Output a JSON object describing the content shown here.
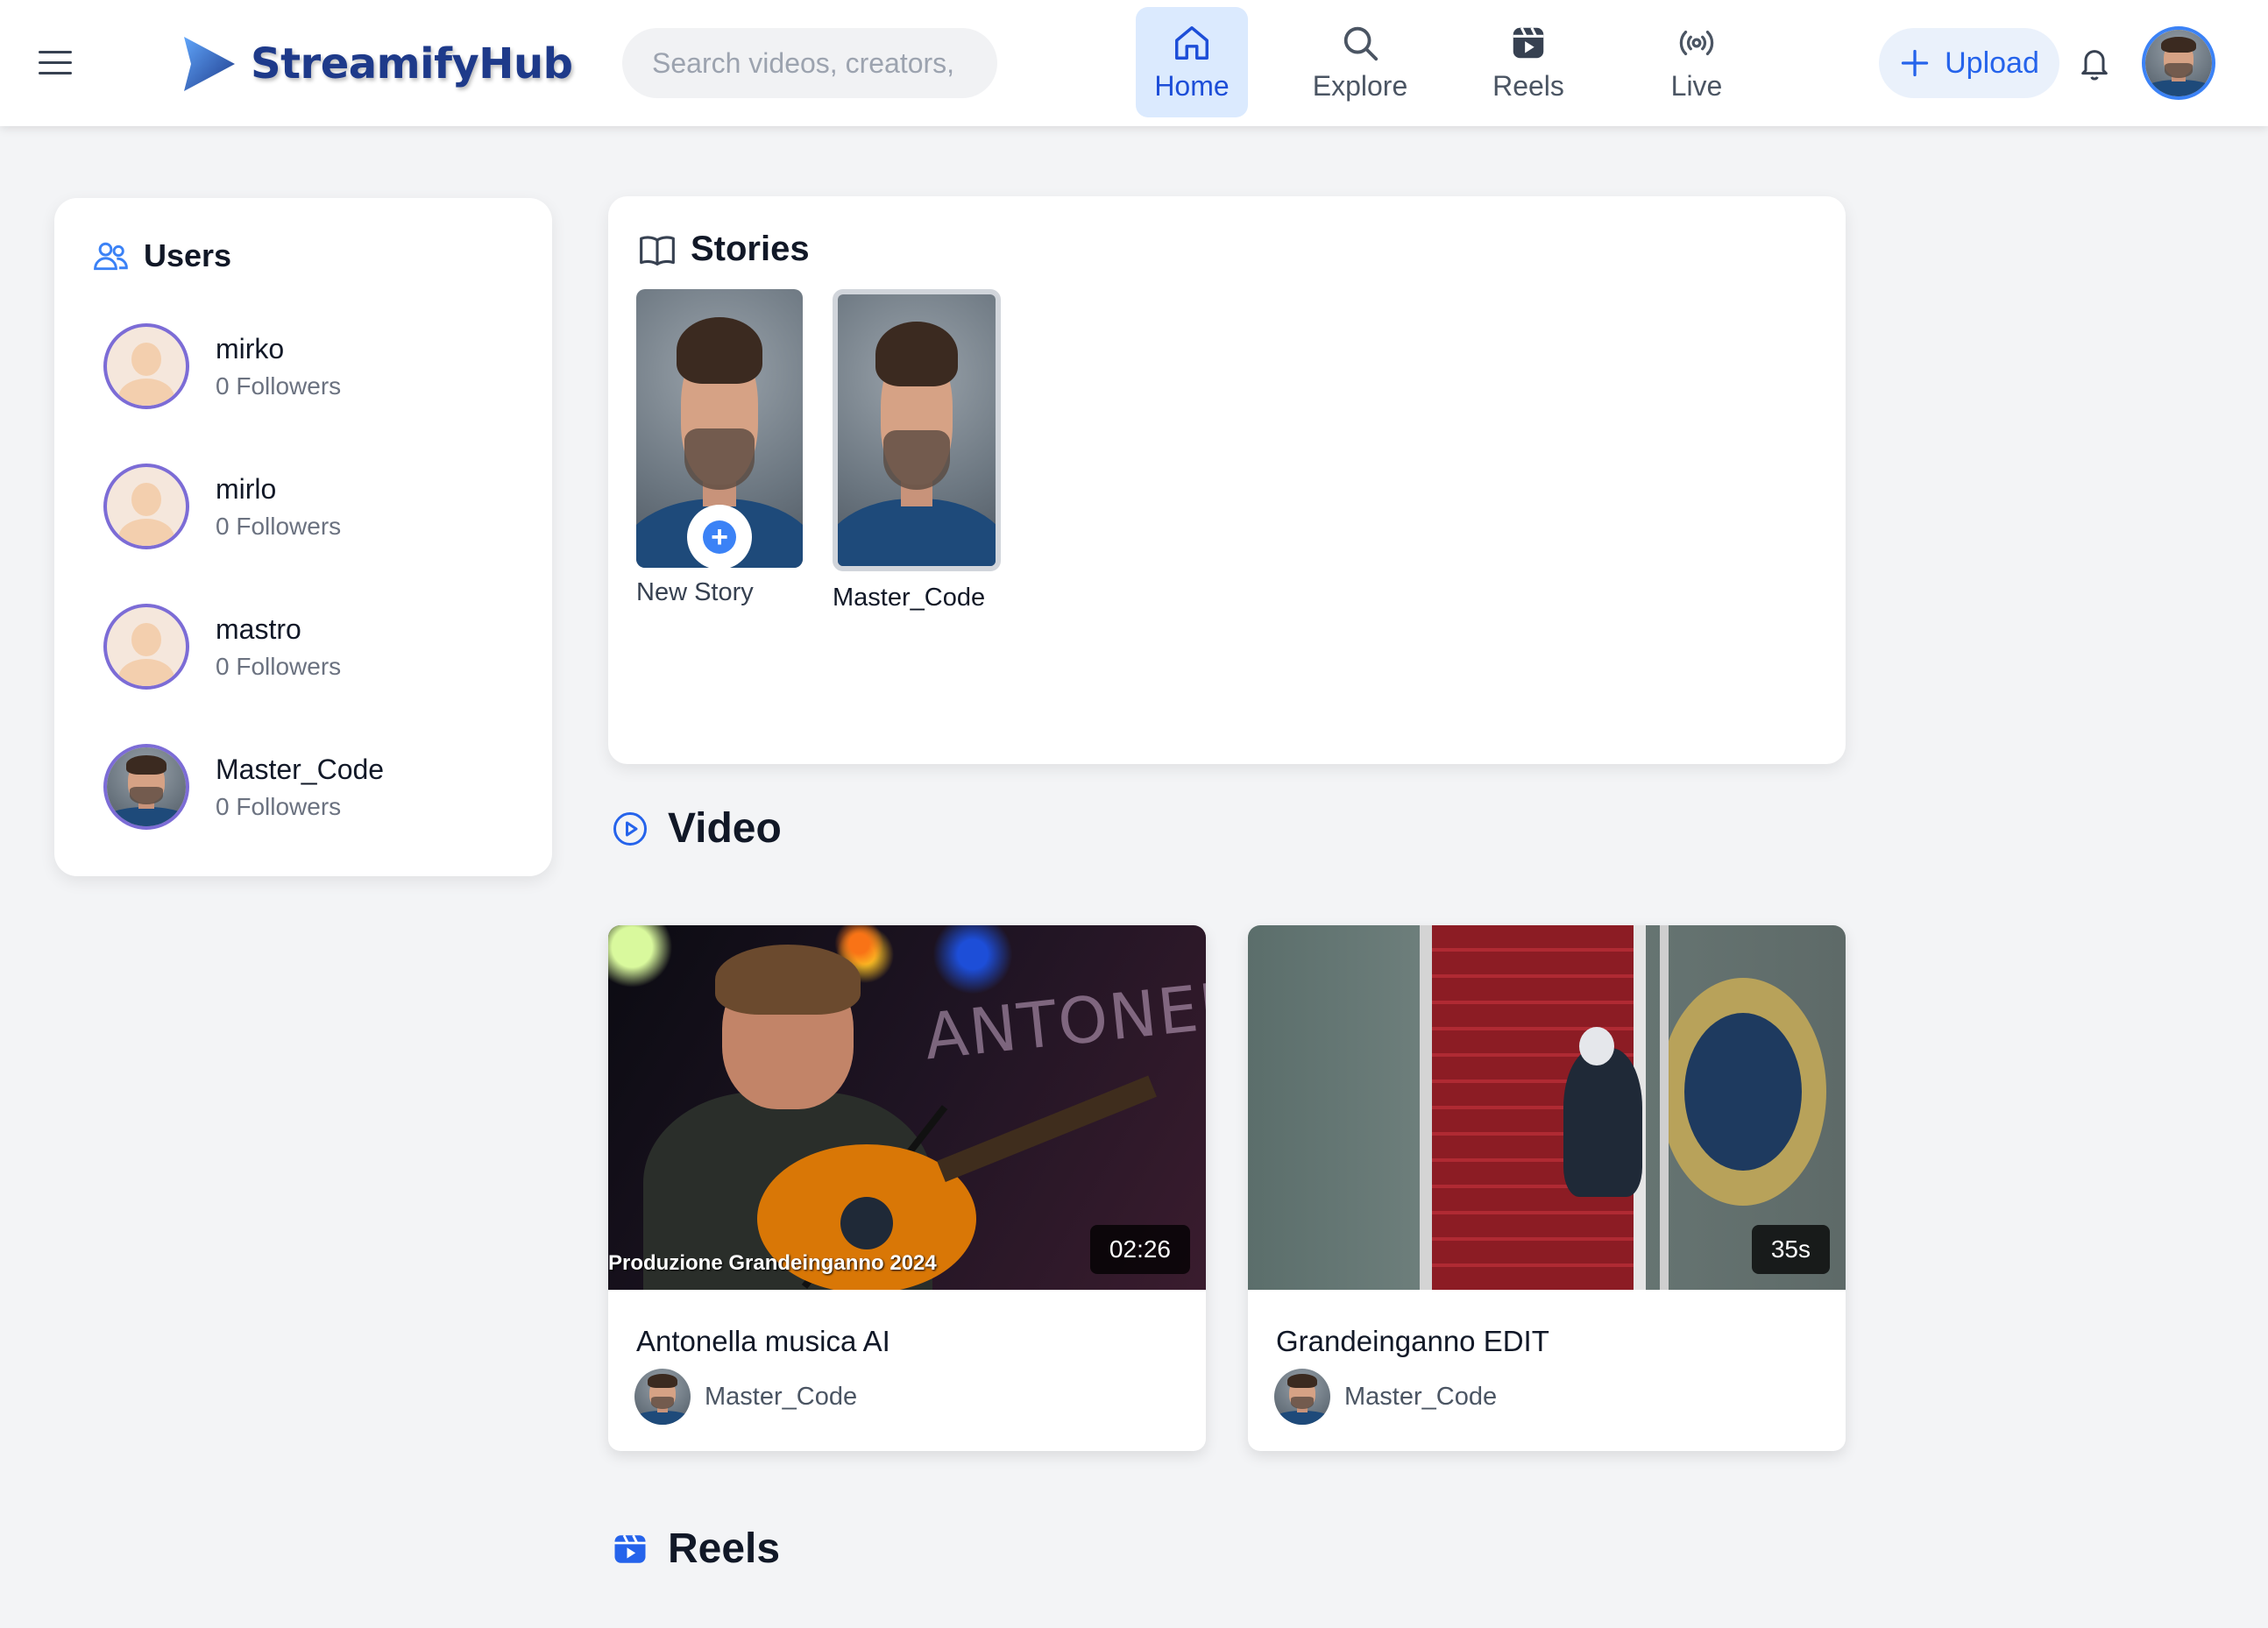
{
  "header": {
    "brand": "StreamifyHub",
    "search_placeholder": "Search videos, creators,",
    "nav": [
      {
        "label": "Home",
        "icon": "home-icon",
        "active": true
      },
      {
        "label": "Explore",
        "icon": "search-icon",
        "active": false
      },
      {
        "label": "Reels",
        "icon": "reels-icon",
        "active": false
      },
      {
        "label": "Live",
        "icon": "live-icon",
        "active": false
      }
    ],
    "upload_label": "Upload",
    "accent_color": "#2563eb"
  },
  "users": {
    "title": "Users",
    "items": [
      {
        "name": "mirko",
        "followers": "0 Followers",
        "avatar": "default-avatar"
      },
      {
        "name": "mirlo",
        "followers": "0 Followers",
        "avatar": "default-avatar"
      },
      {
        "name": "mastro",
        "followers": "0 Followers",
        "avatar": "default-avatar"
      },
      {
        "name": "Master_Code",
        "followers": "0 Followers",
        "avatar": "photo-avatar"
      }
    ]
  },
  "stories": {
    "title": "Stories",
    "items": [
      {
        "label": "New Story"
      },
      {
        "label": "Master_Code"
      }
    ]
  },
  "video_section": {
    "title": "Video",
    "items": [
      {
        "title": "Antonella musica AI",
        "author": "Master_Code",
        "duration": "02:26",
        "thumb_text": "ANTONELLA",
        "thumb_caption": "Produzione Grandeinganno 2024"
      },
      {
        "title": "Grandeinganno EDIT",
        "author": "Master_Code",
        "duration": "35s"
      }
    ]
  },
  "reels_section": {
    "title": "Reels"
  }
}
